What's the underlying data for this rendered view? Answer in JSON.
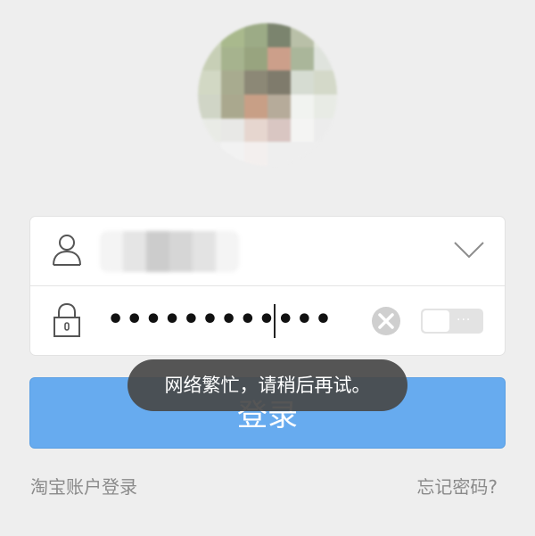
{
  "login_button": {
    "label": "登录"
  },
  "password": {
    "masked_value": "••••••••••••"
  },
  "toast": {
    "message": "网络繁忙，请稍后再试。"
  },
  "links": {
    "taobao_login": "淘宝账户登录",
    "forgot_password": "忘记密码?"
  },
  "toggle": {
    "dots": "···"
  },
  "colors": {
    "background": "#eeeeee",
    "primary_button": "#67abef",
    "toast_bg": "#484848",
    "link_text": "#8a8a8a",
    "icon_gray": "#555555",
    "clear_icon": "#cfcfcf"
  },
  "icons": {
    "user": "user-icon",
    "lock": "lock-icon",
    "dropdown": "chevron-down-icon",
    "clear": "clear-icon"
  }
}
